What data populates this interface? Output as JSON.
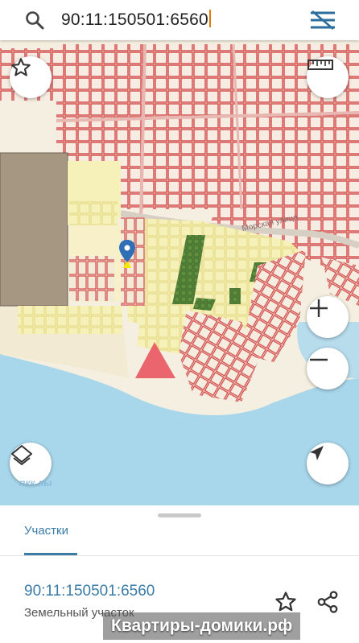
{
  "search": {
    "query": "90:11:150501:6560"
  },
  "map": {
    "road_label": "Морская улица",
    "source_watermark": "пкк.лы"
  },
  "sheet": {
    "tab_label": "Участки",
    "result": {
      "cadastral_number": "90:11:150501:6560",
      "type": "Земельный участок"
    }
  },
  "watermark": "Квартиры-домики.рф",
  "colors": {
    "accent": "#3a7ca5",
    "parcel_outline": "#d9534f",
    "selected_parcel": "#f4ef9a",
    "sea": "#a8d6ea",
    "beach": "#f3ecd6",
    "green_parcel": "#6e9a4a",
    "pin": "#2f6fb5",
    "marker": "#e8525d"
  },
  "icons": {
    "search": "search-icon",
    "filter": "filter-icon",
    "favorite": "star-icon",
    "ruler": "ruler-icon",
    "layers": "layers-icon",
    "zoom_in": "plus-icon",
    "zoom_out": "minus-icon",
    "location": "navigation-arrow-icon",
    "share": "share-icon",
    "pin": "map-pin-icon"
  }
}
